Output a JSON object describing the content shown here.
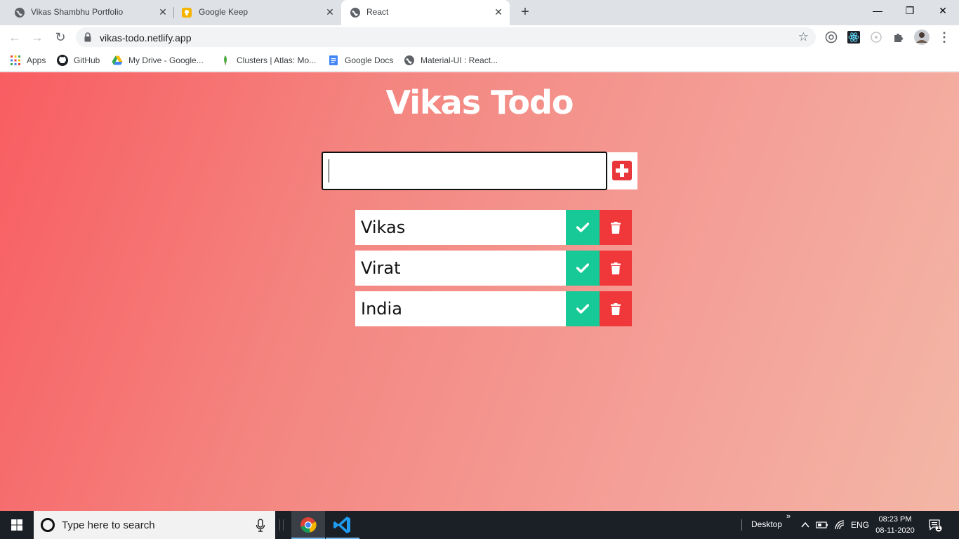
{
  "browser": {
    "tabs": [
      {
        "title": "Vikas Shambhu Portfolio",
        "active": false
      },
      {
        "title": "Google Keep",
        "active": false
      },
      {
        "title": "React",
        "active": true
      }
    ],
    "new_tab_symbol": "+",
    "url": "vikas-todo.netlify.app",
    "bookmarks": [
      {
        "label": "Apps",
        "icon": "apps-grid-icon"
      },
      {
        "label": "GitHub",
        "icon": "github-icon"
      },
      {
        "label": "My Drive - Google...",
        "icon": "google-drive-icon"
      },
      {
        "label": "Clusters | Atlas: Mo...",
        "icon": "mongodb-leaf-icon"
      },
      {
        "label": "Google Docs",
        "icon": "google-docs-icon"
      },
      {
        "label": "Material-UI : React...",
        "icon": "globe-icon"
      }
    ]
  },
  "app": {
    "title": "Vikas Todo",
    "input": {
      "value": "",
      "placeholder": ""
    },
    "todos": [
      {
        "text": "Vikas"
      },
      {
        "text": "Virat"
      },
      {
        "text": "India"
      }
    ],
    "colors": {
      "check": "#17c996",
      "delete": "#f0383b",
      "add": "#e8363b",
      "gradient_start": "#f85d62",
      "gradient_end": "#f3b7a6"
    }
  },
  "taskbar": {
    "search_placeholder": "Type here to search",
    "desktop_label": "Desktop",
    "language": "ENG",
    "time": "08:23 PM",
    "date": "08-11-2020",
    "notification_count": "1"
  }
}
